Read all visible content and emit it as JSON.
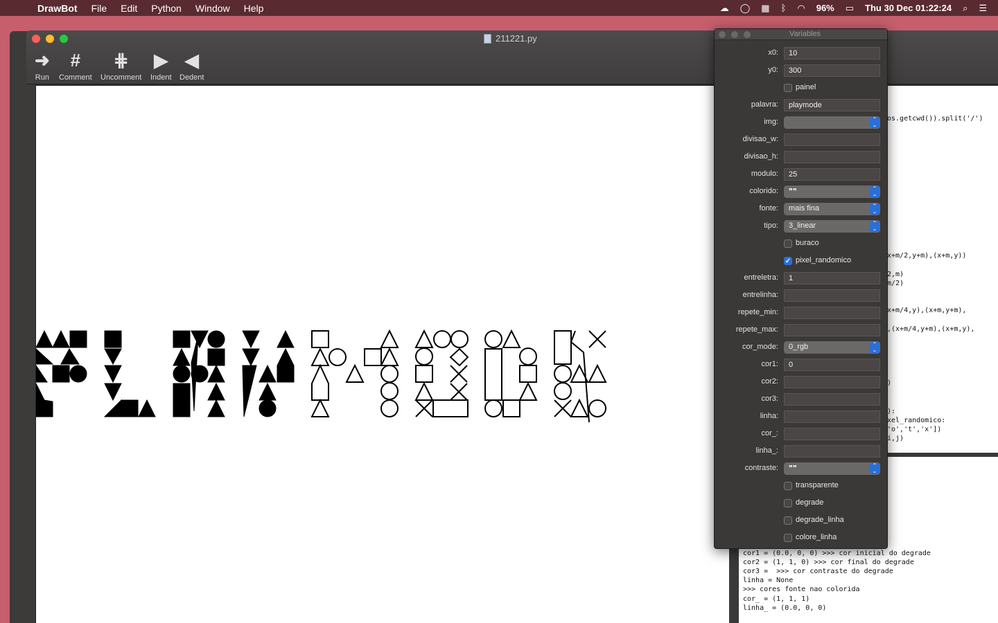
{
  "menubar": {
    "app_name": "DrawBot",
    "items": [
      "File",
      "Edit",
      "Python",
      "Window",
      "Help"
    ],
    "battery": "96%",
    "datetime": "Thu 30 Dec  01:22:24"
  },
  "window": {
    "title": "211221.py",
    "toolbar": [
      {
        "label": "Run",
        "icon": "run-arrow-icon"
      },
      {
        "label": "Comment",
        "icon": "hash-icon"
      },
      {
        "label": "Uncomment",
        "icon": "uncomment-hash-icon"
      },
      {
        "label": "Indent",
        "icon": "indent-icon"
      },
      {
        "label": "Dedent",
        "icon": "dedent-icon"
      }
    ]
  },
  "code_fragments": [
    "os.getcwd()).split('/')",
    "x+m/2,y+m),(x+m,y))",
    "2,m)",
    "m/2)",
    "x+m/4,y),(x+m,y+m),",
    ",(x+m/4,y+m),(x+m,y),",
    ")",
    "):",
    "xel_randomico:",
    "'o','t','x'])",
    "i,j)"
  ],
  "output_lines": [
    "cor1 = (0.0, 0, 0) >>> cor inicial do degrade",
    "cor2 = (1, 1, 0) >>> cor final do degrade",
    "cor3 =  >>> cor contraste do degrade",
    "linha = None",
    ">>> cores fonte nao colorida",
    "cor_ = (1, 1, 1)",
    "linha_ = (0.0, 0, 0)"
  ],
  "variables": {
    "title": "Variables",
    "rows": [
      {
        "label": "x0:",
        "kind": "text",
        "value": "10"
      },
      {
        "label": "y0:",
        "kind": "text",
        "value": "300"
      },
      {
        "label": "",
        "kind": "check",
        "value": "painel",
        "checked": false
      },
      {
        "label": "palavra:",
        "kind": "text",
        "value": "playmode"
      },
      {
        "label": "img:",
        "kind": "select",
        "value": ""
      },
      {
        "label": "divisao_w:",
        "kind": "text",
        "value": ""
      },
      {
        "label": "divisao_h:",
        "kind": "text",
        "value": ""
      },
      {
        "label": "modulo:",
        "kind": "text",
        "value": "25"
      },
      {
        "label": "colorido:",
        "kind": "select",
        "value": "❞❞"
      },
      {
        "label": "fonte:",
        "kind": "select",
        "value": "mais fina"
      },
      {
        "label": "tipo:",
        "kind": "select",
        "value": "3_linear"
      },
      {
        "label": "",
        "kind": "check",
        "value": "buraco",
        "checked": false
      },
      {
        "label": "",
        "kind": "check",
        "value": "pixel_randomico",
        "checked": true
      },
      {
        "label": "entreletra:",
        "kind": "text",
        "value": "1"
      },
      {
        "label": "entrelinha:",
        "kind": "text",
        "value": ""
      },
      {
        "label": "repete_min:",
        "kind": "text",
        "value": ""
      },
      {
        "label": "repete_max:",
        "kind": "text",
        "value": ""
      },
      {
        "label": "cor_mode:",
        "kind": "select",
        "value": "0_rgb"
      },
      {
        "label": "cor1:",
        "kind": "text",
        "value": "0"
      },
      {
        "label": "cor2:",
        "kind": "text",
        "value": ""
      },
      {
        "label": "cor3:",
        "kind": "text",
        "value": ""
      },
      {
        "label": "linha:",
        "kind": "text",
        "value": ""
      },
      {
        "label": "cor_:",
        "kind": "text",
        "value": ""
      },
      {
        "label": "linha_:",
        "kind": "text",
        "value": ""
      },
      {
        "label": "contraste:",
        "kind": "select",
        "value": "❞❞"
      },
      {
        "label": "",
        "kind": "check",
        "value": "transparente",
        "checked": false
      },
      {
        "label": "",
        "kind": "check",
        "value": "degrade",
        "checked": false
      },
      {
        "label": "",
        "kind": "check",
        "value": "degrade_linha",
        "checked": false
      },
      {
        "label": "",
        "kind": "check",
        "value": "colore_linha",
        "checked": false
      }
    ]
  }
}
